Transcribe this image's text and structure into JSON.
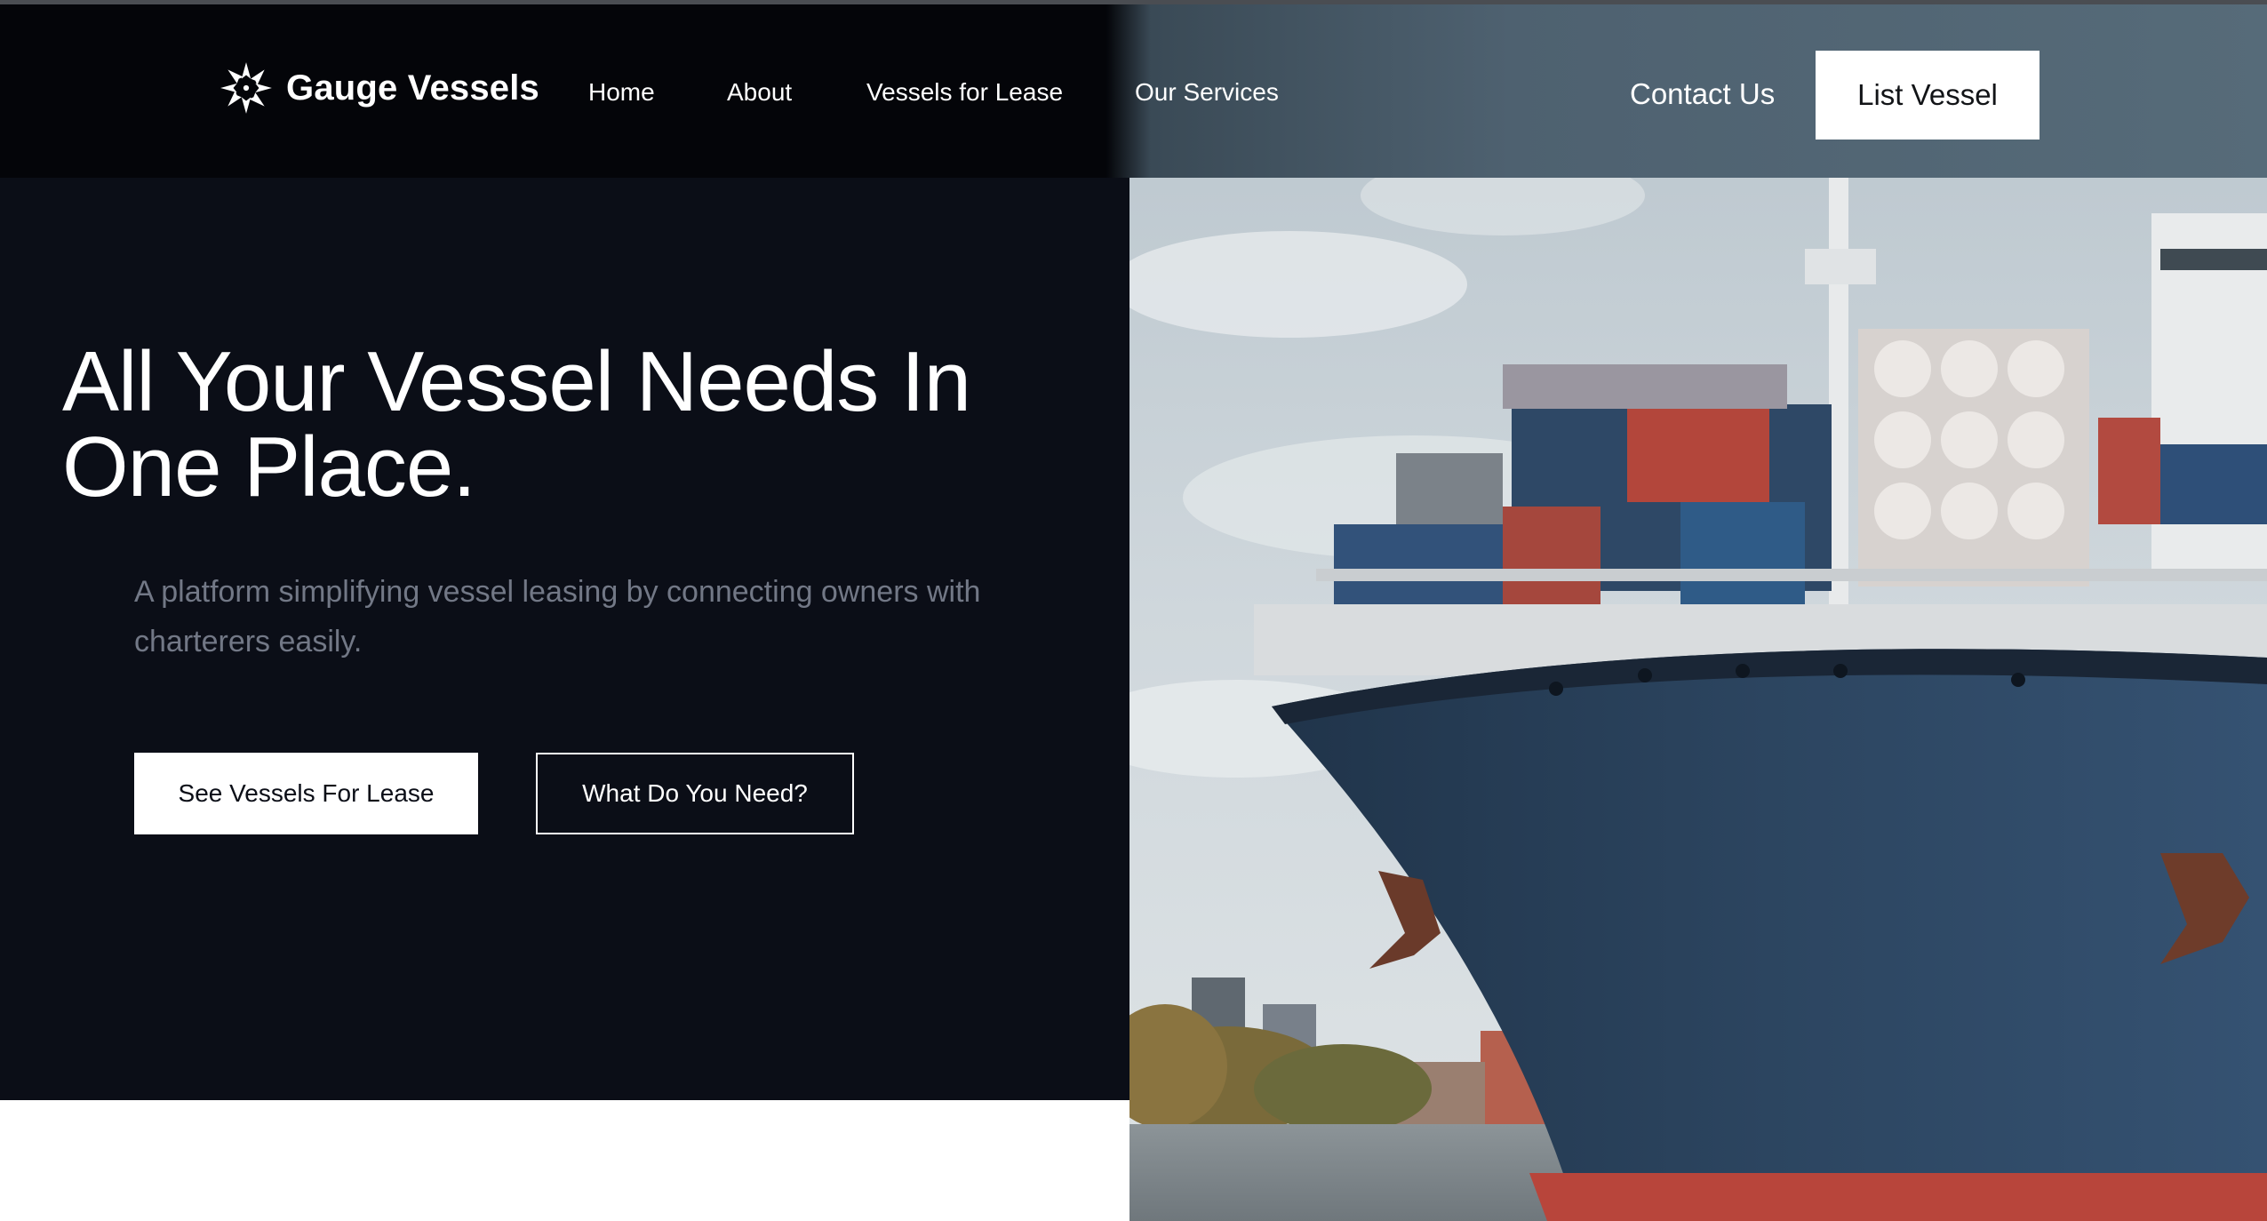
{
  "brand": {
    "name": "Gauge Vessels",
    "logo_icon": "star-compass-icon"
  },
  "nav": {
    "links": [
      "Home",
      "About",
      "Vessels for Lease",
      "Our Services"
    ],
    "contact_label": "Contact Us",
    "list_vessel_label": "List Vessel"
  },
  "hero": {
    "headline": "All Your Vessel Needs In One Place.",
    "subtext": "A platform simplifying vessel leasing by connecting owners with charterers easily.",
    "primary_cta": "See Vessels For Lease",
    "secondary_cta": "What Do You Need?",
    "image_icon": "container-ship-photo"
  },
  "colors": {
    "hero_bg": "#0b0e17",
    "navbar_left": "#040509",
    "navbar_right": "#566b79",
    "subtext": "#727886",
    "button_bg": "#ffffff"
  }
}
